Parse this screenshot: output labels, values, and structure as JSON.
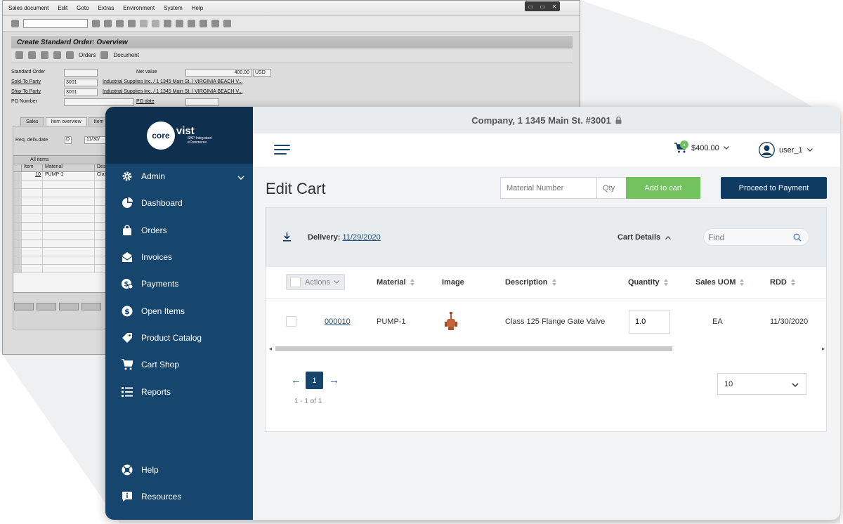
{
  "sap": {
    "menu": [
      "Sales document",
      "Edit",
      "Goto",
      "Extras",
      "Environment",
      "System",
      "Help"
    ],
    "window_controls": [
      "▭",
      "▭",
      "✕"
    ],
    "title": "Create Standard Order: Overview",
    "toolbar_orders_label": "Orders",
    "toolbar_document_label": "Document",
    "fields": {
      "standard_order_label": "Standard Order",
      "net_value_label": "Net value",
      "net_value": "400.00",
      "currency": "USD",
      "sold_to_label": "Sold-To Party",
      "sold_to_value": "3001",
      "sold_to_text": "Industrial Supplies Inc. / 1 1345 Main St. / VIRGINIA BEACH V...",
      "ship_to_label": "Ship-To Party",
      "ship_to_value": "3001",
      "ship_to_text": "Industrial Supplies Inc. / 1 1345 Main St. / VIRGINIA BEACH V...",
      "po_number_label": "PO Number",
      "po_date_label": "PO date",
      "req_deliv_label": "Req. deliv.date",
      "req_deliv_unit": "D",
      "req_deliv_value": "11/30/"
    },
    "tabs": [
      "Sales",
      "Item overview",
      "Item"
    ],
    "all_items_label": "All items",
    "columns": [
      "Item",
      "Material",
      "Desc"
    ],
    "rows": [
      {
        "item": "10",
        "material": "PUMP-1",
        "desc": "Clas"
      }
    ]
  },
  "app": {
    "company": "Company, 1 1345 Main St. #3001",
    "logo": {
      "mark": "core",
      "name": "vist",
      "sub1": "SAP-Integrated",
      "sub2": "eCommerce"
    },
    "nav": [
      {
        "label": "Admin",
        "icon": "gear-icon"
      },
      {
        "label": "Dashboard",
        "icon": "pie-chart-icon"
      },
      {
        "label": "Orders",
        "icon": "shopping-bag-icon"
      },
      {
        "label": "Invoices",
        "icon": "envelope-icon"
      },
      {
        "label": "Payments",
        "icon": "payment-icon"
      },
      {
        "label": "Open Items",
        "icon": "dollar-icon"
      },
      {
        "label": "Product Catalog",
        "icon": "tag-icon"
      },
      {
        "label": "Cart Shop",
        "icon": "cart-icon"
      },
      {
        "label": "Reports",
        "icon": "list-icon"
      }
    ],
    "nav_bottom": [
      {
        "label": "Help",
        "icon": "help-icon"
      },
      {
        "label": "Resources",
        "icon": "info-icon"
      }
    ],
    "header": {
      "cart_count": "1",
      "cart_total": "$400.00",
      "username": "user_1"
    },
    "page_title": "Edit Cart",
    "material_placeholder": "Material Number",
    "qty_placeholder": "Qty",
    "add_to_cart_label": "Add to cart",
    "proceed_label": "Proceed to Payment",
    "delivery_label": "Delivery:",
    "delivery_date": "11/29/2020",
    "cart_details_label": "Cart Details",
    "find_placeholder": "Find",
    "table": {
      "actions_label": "Actions",
      "headers": {
        "material": "Material",
        "image": "Image",
        "description": "Description",
        "quantity": "Quantity",
        "sales_uom": "Sales UOM",
        "rdd": "RDD"
      },
      "rows": [
        {
          "item": "000010",
          "material": "PUMP-1",
          "description": "Class 125 Flange Gate Valve",
          "quantity": "1.0",
          "uom": "EA",
          "rdd": "11/30/2020"
        }
      ]
    },
    "pagination": {
      "current_page": "1",
      "prev": "←",
      "next": "→",
      "range": "1 - 1 of 1",
      "page_size": "10"
    },
    "colors": {
      "sidebar": "#16466e",
      "brand": "#0f2f4e",
      "add_button": "#72c35f",
      "pay_button": "#0f3a62"
    }
  }
}
